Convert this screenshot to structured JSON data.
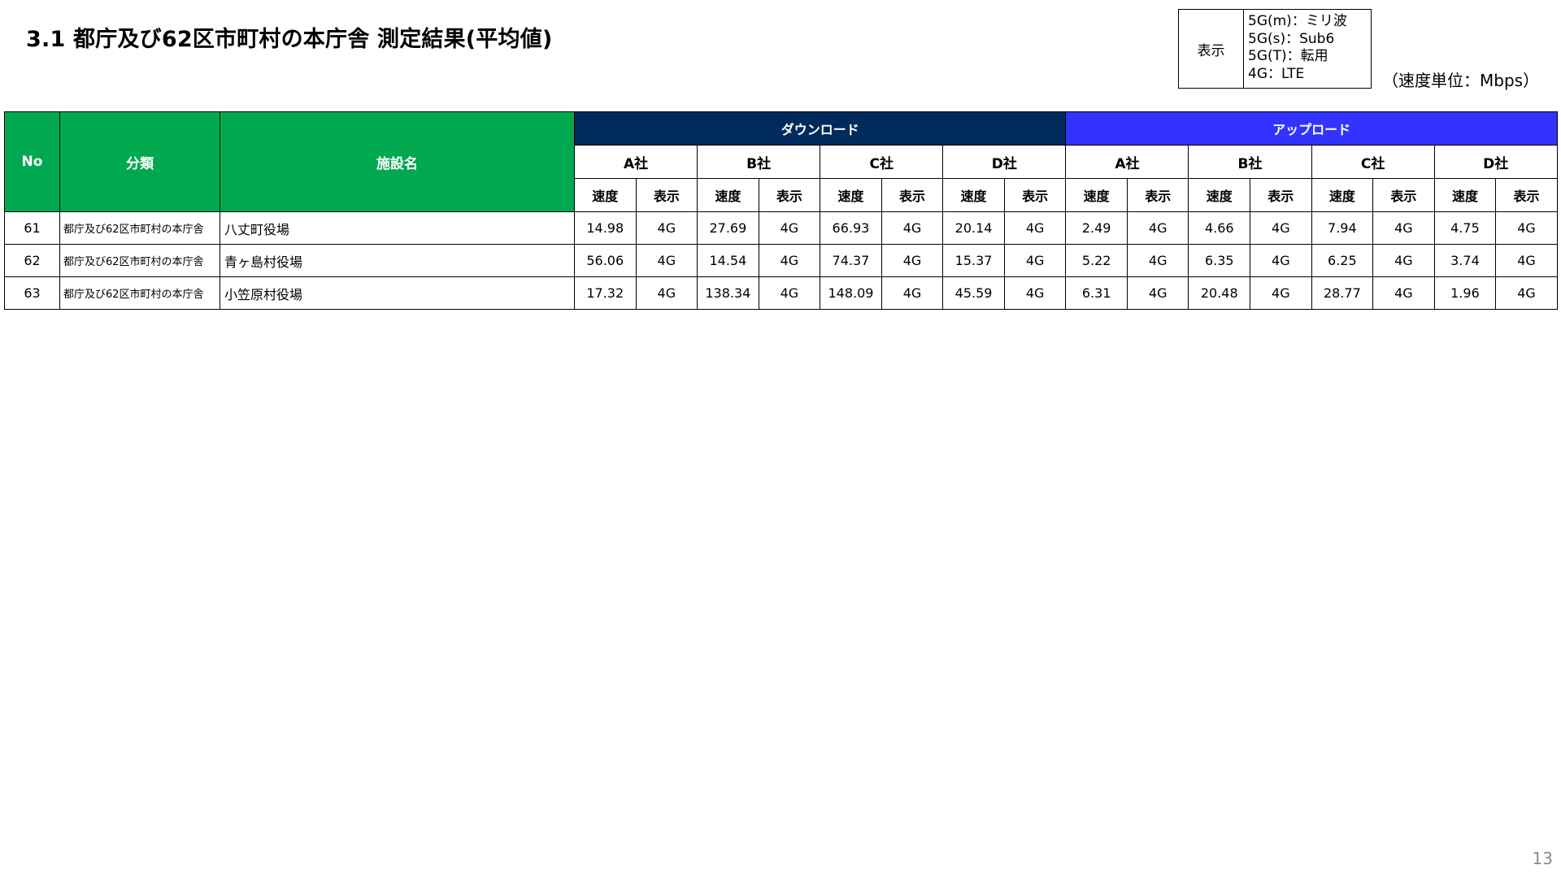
{
  "title": "3.1 都庁及び62区市町村の本庁舎 測定結果(平均値)",
  "legend": {
    "key": "表示",
    "lines": [
      "5G(m)：ミリ波",
      "5G(s)：Sub6",
      "5G(T)：転用",
      "4G：LTE"
    ]
  },
  "unit_note": "（速度単位：Mbps）",
  "table": {
    "headers": {
      "no": "No",
      "category": "分類",
      "facility": "施設名",
      "download": "ダウンロード",
      "upload": "アップロード",
      "companies": [
        "A社",
        "B社",
        "C社",
        "D社"
      ],
      "speed": "速度",
      "display": "表示"
    },
    "rows": [
      {
        "no": "61",
        "category": "都庁及び62区市町村の本庁舎",
        "facility": "八丈町役場",
        "cells": [
          "14.98",
          "4G",
          "27.69",
          "4G",
          "66.93",
          "4G",
          "20.14",
          "4G",
          "2.49",
          "4G",
          "4.66",
          "4G",
          "7.94",
          "4G",
          "4.75",
          "4G"
        ]
      },
      {
        "no": "62",
        "category": "都庁及び62区市町村の本庁舎",
        "facility": "青ヶ島村役場",
        "cells": [
          "56.06",
          "4G",
          "14.54",
          "4G",
          "74.37",
          "4G",
          "15.37",
          "4G",
          "5.22",
          "4G",
          "6.35",
          "4G",
          "6.25",
          "4G",
          "3.74",
          "4G"
        ]
      },
      {
        "no": "63",
        "category": "都庁及び62区市町村の本庁舎",
        "facility": "小笠原村役場",
        "cells": [
          "17.32",
          "4G",
          "138.34",
          "4G",
          "148.09",
          "4G",
          "45.59",
          "4G",
          "6.31",
          "4G",
          "20.48",
          "4G",
          "28.77",
          "4G",
          "1.96",
          "4G"
        ]
      }
    ]
  },
  "page_number": "13",
  "colors": {
    "header_green": "#00a94f",
    "download_navy": "#002b5c",
    "upload_blue": "#3333ff"
  }
}
